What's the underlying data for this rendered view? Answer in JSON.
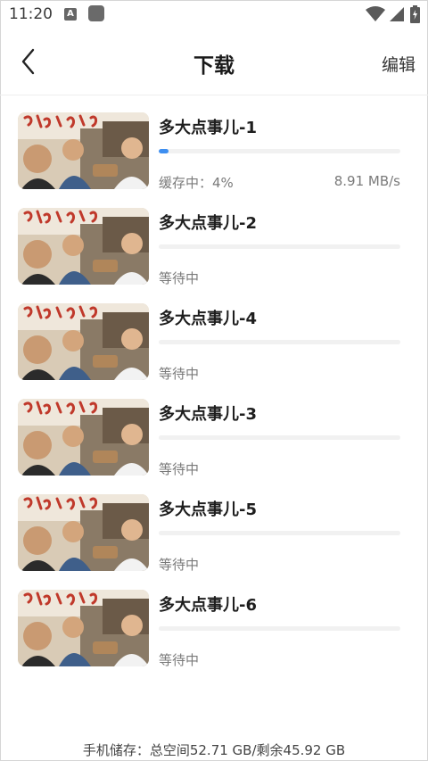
{
  "status_bar": {
    "time": "11:20",
    "a_badge": "A"
  },
  "header": {
    "back_icon": "chevron-left-icon",
    "title": "下载",
    "edit_label": "编辑"
  },
  "downloads": [
    {
      "title": "多大点事儿-1",
      "status": "缓存中：4%",
      "speed": "8.91 MB/s",
      "progress": 0.04
    },
    {
      "title": "多大点事儿-2",
      "status": "等待中",
      "speed": "",
      "progress": 0
    },
    {
      "title": "多大点事儿-4",
      "status": "等待中",
      "speed": "",
      "progress": 0
    },
    {
      "title": "多大点事儿-3",
      "status": "等待中",
      "speed": "",
      "progress": 0
    },
    {
      "title": "多大点事儿-5",
      "status": "等待中",
      "speed": "",
      "progress": 0
    },
    {
      "title": "多大点事儿-6",
      "status": "等待中",
      "speed": "",
      "progress": 0
    }
  ],
  "footer": {
    "storage": "手机储存：总空间52.71 GB/剩余45.92 GB"
  },
  "colors": {
    "accent": "#3d8ef0",
    "track": "#f1f1f1"
  }
}
